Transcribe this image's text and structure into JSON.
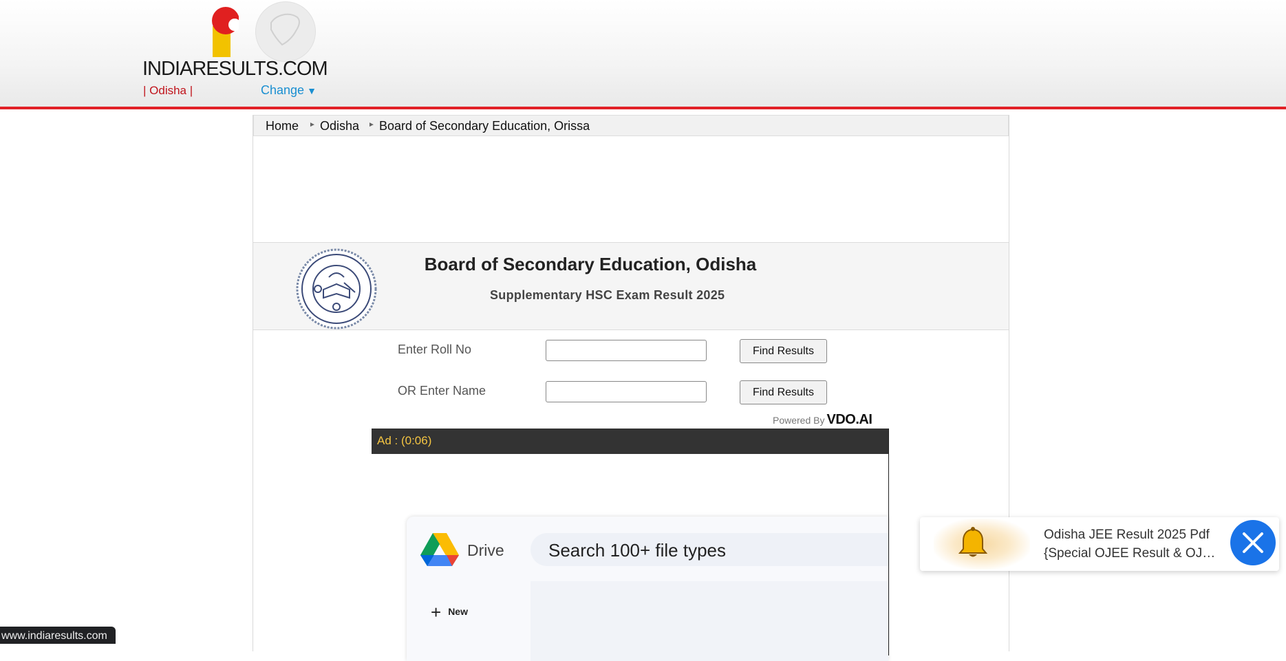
{
  "header": {
    "logo_text": "INDIARESULTS.COM",
    "state_label": "| Odisha  |",
    "change_label": "Change",
    "change_icon": "triangle-down-icon",
    "accent_color": "#e12027",
    "link_color": "#1a8fd1"
  },
  "breadcrumb": {
    "items": [
      "Home",
      "Odisha",
      "Board of Secondary Education, Orissa"
    ]
  },
  "banner": {
    "title": "Board of Secondary Education, Odisha",
    "subtitle": "Supplementary HSC Exam Result 2025",
    "seal_text": "BOARD OF SECONDARY EDUCATION ORISSA"
  },
  "form": {
    "roll_label": "Enter Roll No",
    "roll_value": "",
    "name_label": "OR Enter Name",
    "name_value": "",
    "button_label": "Find Results"
  },
  "video_ad": {
    "powered_by": "Powered By",
    "brand": "VDO.AI",
    "ad_label": "Ad : (0:06)",
    "drive_name": "Drive",
    "drive_search": "Search 100+ file types",
    "drive_new": "New"
  },
  "notification": {
    "line1": "Odisha JEE Result 2025 Pdf",
    "line2": "{Special OJEE Result & OJ…",
    "icon": "bell-icon",
    "close_icon": "close-icon"
  },
  "status_bar": {
    "url": "www.indiaresults.com"
  }
}
